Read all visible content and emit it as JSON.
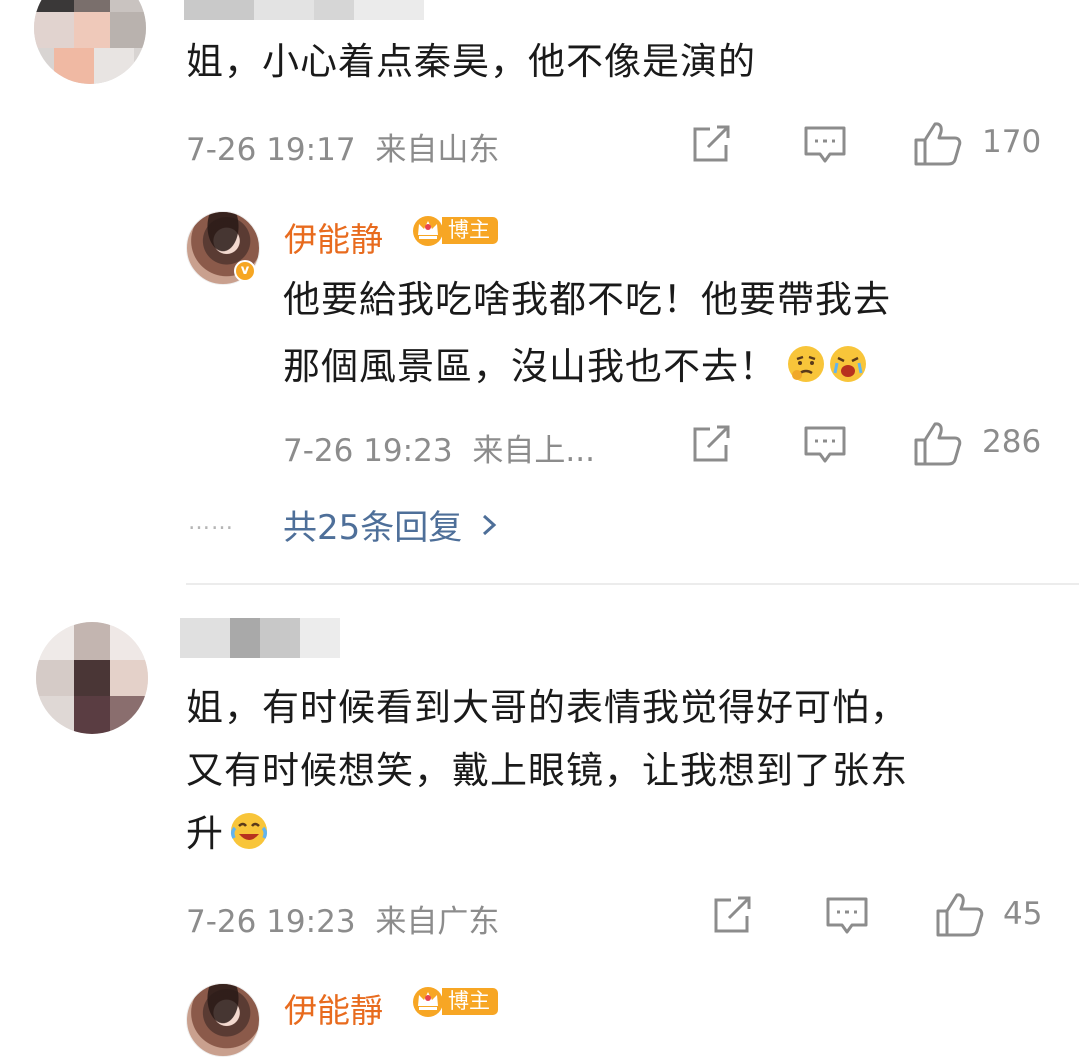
{
  "comments": [
    {
      "text": "姐，小心着点秦昊，他不像是演的",
      "time": "7-26 19:17",
      "location": "来自山东",
      "likes": "170",
      "reply": {
        "author": "伊能静",
        "badge": "博主",
        "text_line1": "他要給我吃啥我都不吃！他要帶我去",
        "text_line2": "那個風景區，沒山我也不去！",
        "time": "7-26 19:23",
        "location": "来自上...",
        "likes": "286"
      },
      "more_replies": "共25条回复",
      "more_dots": "……"
    },
    {
      "text_line1": "姐，有时候看到大哥的表情我觉得好可怕，",
      "text_line2": "又有时候想笑，戴上眼镜，让我想到了张东",
      "text_line3": "升",
      "time": "7-26 19:23",
      "location": "来自广东",
      "likes": "45",
      "reply": {
        "author": "伊能靜",
        "badge": "博主"
      }
    }
  ],
  "colors": {
    "author": "#e86b1e",
    "badge": "#f7a624",
    "link": "#4e6f99",
    "meta": "#8c8c8c"
  },
  "icons": [
    "share-icon",
    "comment-icon",
    "like-icon",
    "chevron-right-icon"
  ]
}
